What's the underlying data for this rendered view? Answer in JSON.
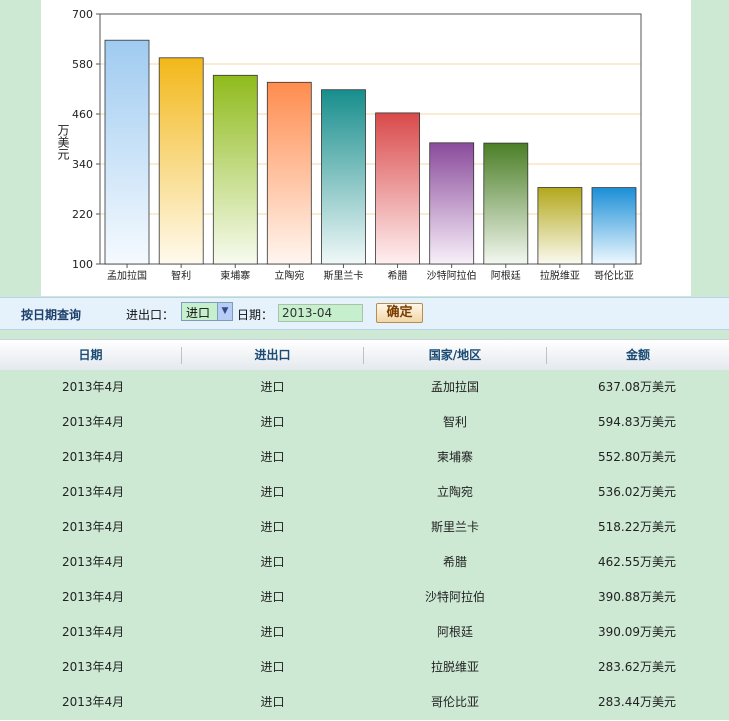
{
  "chart_data": {
    "type": "bar",
    "categories": [
      "孟加拉国",
      "智利",
      "柬埔寨",
      "立陶宛",
      "斯里兰卡",
      "希腊",
      "沙特阿拉伯",
      "阿根廷",
      "拉脱维亚",
      "哥伦比亚"
    ],
    "values": [
      637.08,
      594.83,
      552.8,
      536.02,
      518.22,
      462.55,
      390.88,
      390.09,
      283.62,
      283.44
    ],
    "ylabel": "万美元",
    "ylim": [
      100,
      700
    ],
    "yticks": [
      100,
      220,
      340,
      460,
      580,
      700
    ],
    "grid": true,
    "colors": [
      [
        "#9fcbf0",
        "#f5faff"
      ],
      [
        "#f2b81a",
        "#fffaee"
      ],
      [
        "#8fbb1c",
        "#f7fbef"
      ],
      [
        "#ff8c4e",
        "#fff6f0"
      ],
      [
        "#178e8c",
        "#f0f8f8"
      ],
      [
        "#d94a4a",
        "#fff0f1"
      ],
      [
        "#8a4b9b",
        "#f8f0fa"
      ],
      [
        "#4b7f26",
        "#f3f7f0"
      ],
      [
        "#b3a81c",
        "#fafaf0"
      ],
      [
        "#1b8fd6",
        "#eef8ff"
      ]
    ]
  },
  "filter": {
    "title": "按日期查询",
    "type_label": "进出口：",
    "type_value": "进口",
    "date_label": "日期：",
    "date_value": "2013-04",
    "confirm_label": "确定"
  },
  "table": {
    "headers": [
      "日期",
      "进出口",
      "国家/地区",
      "金额"
    ],
    "rows": [
      [
        "2013年4月",
        "进口",
        "孟加拉国",
        "637.08万美元"
      ],
      [
        "2013年4月",
        "进口",
        "智利",
        "594.83万美元"
      ],
      [
        "2013年4月",
        "进口",
        "柬埔寨",
        "552.80万美元"
      ],
      [
        "2013年4月",
        "进口",
        "立陶宛",
        "536.02万美元"
      ],
      [
        "2013年4月",
        "进口",
        "斯里兰卡",
        "518.22万美元"
      ],
      [
        "2013年4月",
        "进口",
        "希腊",
        "462.55万美元"
      ],
      [
        "2013年4月",
        "进口",
        "沙特阿拉伯",
        "390.88万美元"
      ],
      [
        "2013年4月",
        "进口",
        "阿根廷",
        "390.09万美元"
      ],
      [
        "2013年4月",
        "进口",
        "拉脱维亚",
        "283.62万美元"
      ],
      [
        "2013年4月",
        "进口",
        "哥伦比亚",
        "283.44万美元"
      ]
    ]
  }
}
